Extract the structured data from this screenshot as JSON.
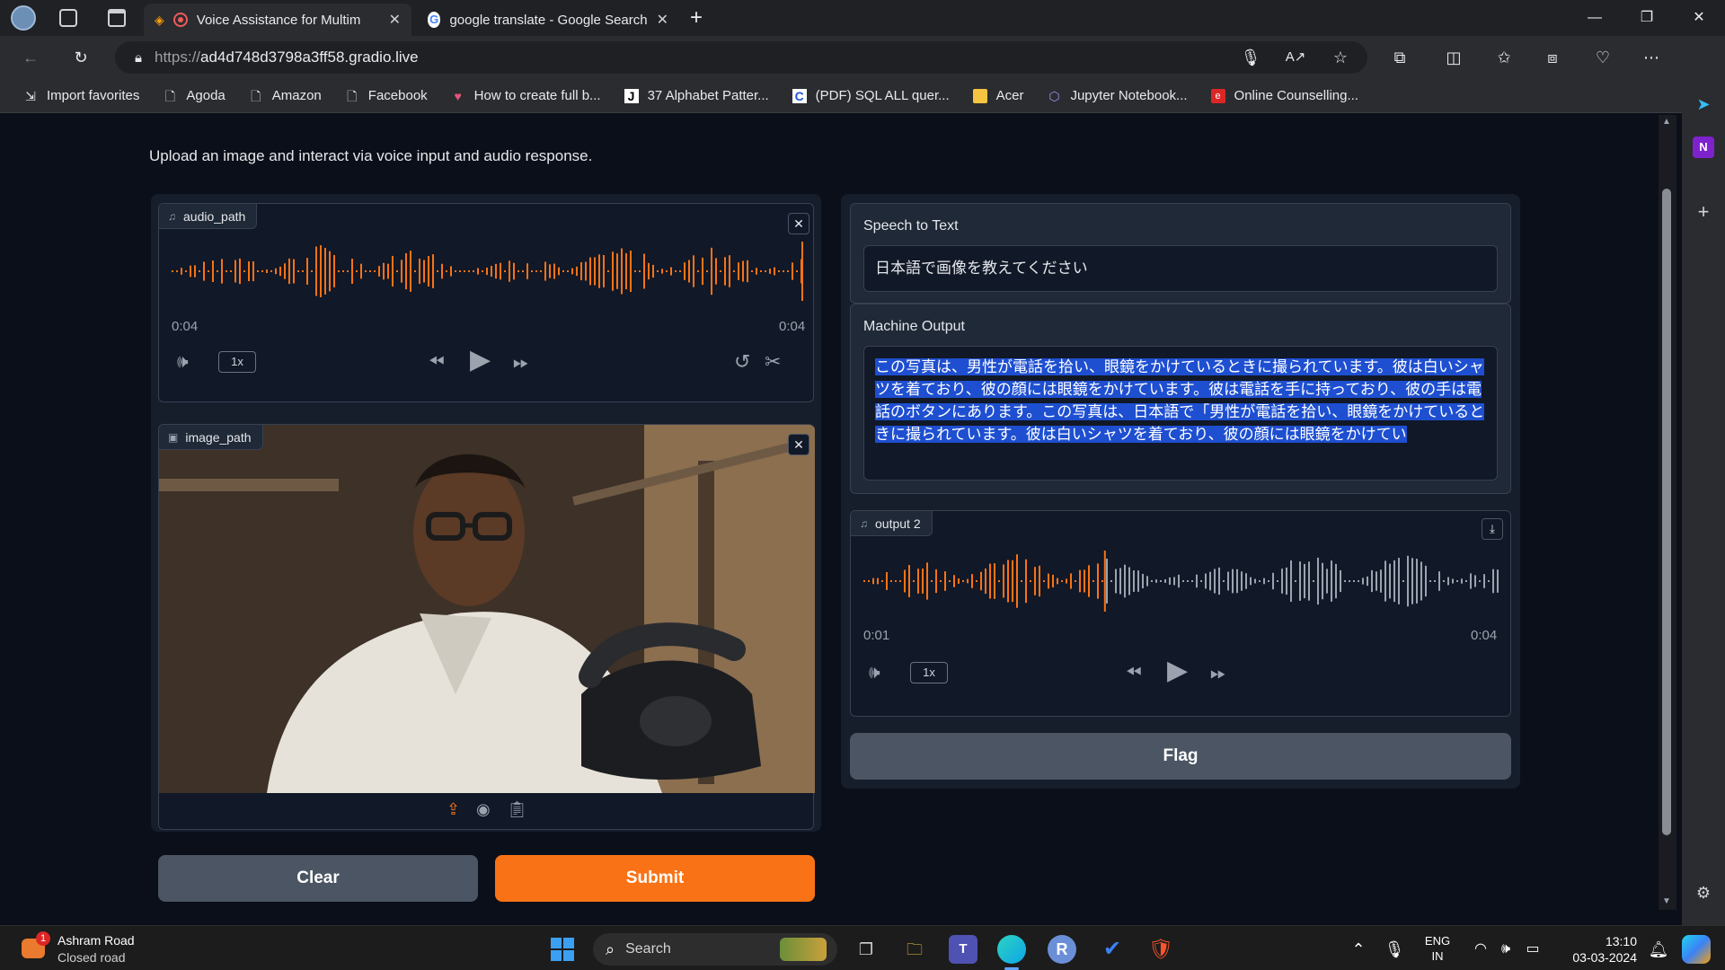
{
  "browser": {
    "tabs": [
      {
        "title": "Voice Assistance for Multim",
        "active": true
      },
      {
        "title": "google translate - Google Search",
        "active": false
      }
    ],
    "url": {
      "scheme": "https://",
      "host": "ad4d748d3798a3ff58.gradio.live"
    },
    "bookmarks": [
      {
        "label": "Import favorites",
        "icon": "import-icon"
      },
      {
        "label": "Agoda",
        "icon": "page-icon"
      },
      {
        "label": "Amazon",
        "icon": "page-icon"
      },
      {
        "label": "Facebook",
        "icon": "page-icon"
      },
      {
        "label": "How to create full b...",
        "icon": "site-icon"
      },
      {
        "label": "37 Alphabet Patter...",
        "icon": "j-icon"
      },
      {
        "label": "(PDF) SQL ALL quer...",
        "icon": "c-icon"
      },
      {
        "label": "Acer",
        "icon": "folder-icon"
      },
      {
        "label": "Jupyter Notebook...",
        "icon": "jupyter-icon"
      },
      {
        "label": "Online Counselling...",
        "icon": "site-icon"
      }
    ]
  },
  "app": {
    "description": "Upload an image and interact via voice input and audio response.",
    "audio_input": {
      "label": "audio_path",
      "current_time": "0:04",
      "duration": "0:04",
      "speed": "1x",
      "progress": 1.0
    },
    "image_input": {
      "label": "image_path"
    },
    "speech_to_text": {
      "label": "Speech to Text",
      "value": "日本語で画像を教えてください"
    },
    "machine_output": {
      "label": "Machine Output",
      "value": "この写真は、男性が電話を拾い、眼鏡をかけているときに撮られています。彼は白いシャツを着ており、彼の顔には眼鏡をかけています。彼は電話を手に持っており、彼の手は電話のボタンにあります。この写真は、日本語で「男性が電話を拾い、眼鏡をかけているときに撮られています。彼は白いシャツを着ており、彼の顔には眼鏡をかけてい"
    },
    "audio_output": {
      "label": "output 2",
      "current_time": "0:01",
      "duration": "0:04",
      "speed": "1x",
      "progress": 0.38
    },
    "buttons": {
      "clear": "Clear",
      "submit": "Submit",
      "flag": "Flag"
    },
    "colors": {
      "accent": "#f97316",
      "panel": "#1f2937",
      "background": "#0b0f19"
    }
  },
  "taskbar": {
    "weather_title": "Ashram Road",
    "weather_sub": "Closed road",
    "notification_count": "1",
    "search_placeholder": "Search",
    "lang_top": "ENG",
    "lang_bottom": "IN",
    "time": "13:10",
    "date": "03-03-2024"
  }
}
